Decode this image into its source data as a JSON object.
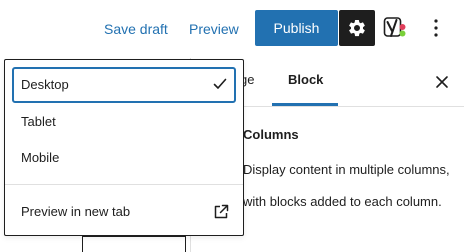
{
  "toolbar": {
    "save_draft_label": "Save draft",
    "preview_label": "Preview",
    "publish_label": "Publish",
    "settings_icon": "gear-icon",
    "yoast_icon": "yoast-seo-icon",
    "more_icon": "more-vertical-icon",
    "accent_color": "#2271b1"
  },
  "sidebar": {
    "tabs": [
      {
        "label": "ge",
        "active": false
      },
      {
        "label": "Block",
        "active": true
      }
    ],
    "close_icon": "close-icon",
    "block": {
      "name": "Columns",
      "description": "Display content in multiple columns, with blocks added to each column."
    }
  },
  "preview_menu": {
    "items": [
      {
        "label": "Desktop",
        "selected": true,
        "icon": "check-icon"
      },
      {
        "label": "Tablet",
        "selected": false
      },
      {
        "label": "Mobile",
        "selected": false
      }
    ],
    "new_tab": {
      "label": "Preview in new tab",
      "icon": "external-link-icon"
    }
  }
}
